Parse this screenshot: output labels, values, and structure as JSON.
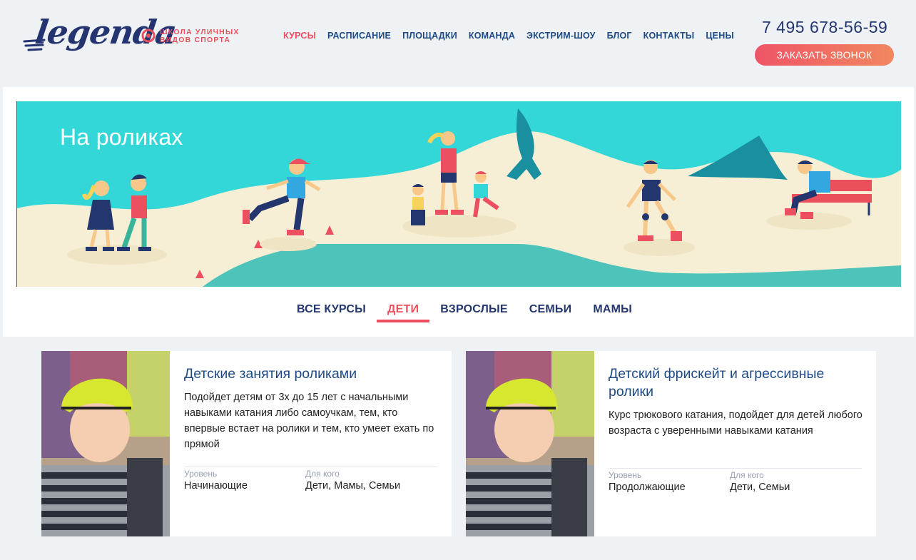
{
  "brand": {
    "logo_text": "legenda",
    "tagline_line1": "школа уличных",
    "tagline_line2": "видов спорта",
    "accent": "#ec5060",
    "navy": "#24366e"
  },
  "nav": [
    {
      "label": "КУРСЫ",
      "active": true
    },
    {
      "label": "РАСПИСАНИЕ"
    },
    {
      "label": "ПЛОЩАДКИ"
    },
    {
      "label": "КОМАНДА"
    },
    {
      "label": "ЭКСТРИМ-ШОУ"
    },
    {
      "label": "БЛОГ"
    },
    {
      "label": "КОНТАКТЫ"
    },
    {
      "label": "ЦЕНЫ"
    }
  ],
  "contact": {
    "phone": "7 495 678-56-59",
    "callback_label": "ЗАКАЗАТЬ ЗВОНОК"
  },
  "banner": {
    "title": "На роликах",
    "colors": {
      "sky": "#33d7d8",
      "sand": "#f6efd6",
      "water": "#4ec3b9"
    }
  },
  "tabs": [
    {
      "label": "ВСЕ КУРСЫ"
    },
    {
      "label": "ДЕТИ",
      "active": true
    },
    {
      "label": "ВЗРОСЛЫЕ"
    },
    {
      "label": "СЕМЬИ"
    },
    {
      "label": "МАМЫ"
    }
  ],
  "cards": [
    {
      "title": "Детские занятия роликами",
      "description": "Подойдет детям от 3х до 15 лет с начальными навыками катания либо самоучкам, тем, кто впервые встает на ролики и тем, кто умеет ехать по прямой",
      "level_label": "Уровень",
      "level_value": "Начинающие",
      "audience_label": "Для кого",
      "audience_value": "Дети, Мамы, Семьи"
    },
    {
      "title": "Детский фрискейт и агрессивные ролики",
      "description": "Курс трюкового катания, подойдет для детей любого возраста с уверенными навыками катания",
      "level_label": "Уровень",
      "level_value": "Продолжающие",
      "audience_label": "Для кого",
      "audience_value": "Дети, Семьи"
    }
  ]
}
